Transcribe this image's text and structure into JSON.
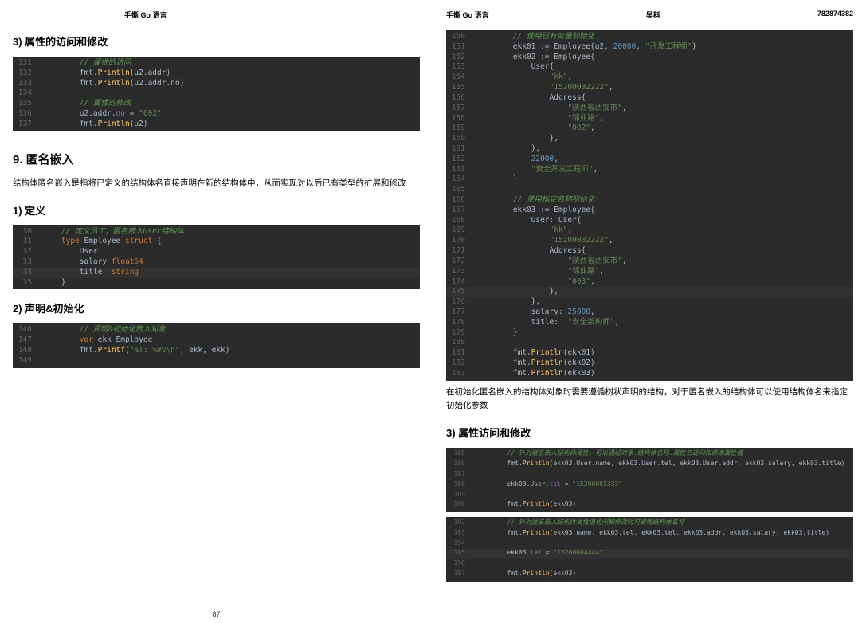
{
  "header": {
    "title": "手撕 Go 语言",
    "author": "吴科",
    "id": "782874382"
  },
  "left": {
    "h1": "3) 属性的访问和修改",
    "code1": [
      {
        "n": 131,
        "seg": [
          {
            "c": "cm",
            "t": "// 属性的访问"
          }
        ],
        "ind": 2
      },
      {
        "n": 132,
        "seg": [
          {
            "c": "",
            "t": "fmt."
          },
          {
            "c": "fn",
            "t": "Println"
          },
          {
            "c": "",
            "t": "(u2.addr)"
          }
        ],
        "ind": 2
      },
      {
        "n": 133,
        "seg": [
          {
            "c": "",
            "t": "fmt."
          },
          {
            "c": "fn",
            "t": "Println"
          },
          {
            "c": "",
            "t": "(u2.addr.no)"
          }
        ],
        "ind": 2
      },
      {
        "n": 134,
        "seg": [],
        "ind": 0
      },
      {
        "n": 135,
        "seg": [
          {
            "c": "cm",
            "t": "// 属性的修改"
          }
        ],
        "ind": 2
      },
      {
        "n": 136,
        "seg": [
          {
            "c": "",
            "t": "u2.addr."
          },
          {
            "c": "id",
            "t": "no"
          },
          {
            "c": "",
            "t": " = "
          },
          {
            "c": "str",
            "t": "\"002\""
          }
        ],
        "ind": 2
      },
      {
        "n": 137,
        "seg": [
          {
            "c": "",
            "t": "fmt."
          },
          {
            "c": "fn",
            "t": "Println"
          },
          {
            "c": "",
            "t": "(u2)"
          }
        ],
        "ind": 2
      }
    ],
    "h2": "9. 匿名嵌入",
    "p1": "结构体匿名嵌入是指将已定义的结构体名直接声明在新的结构体中，从而实现对以后已有类型的扩展和修改",
    "h3": "1) 定义",
    "code2": [
      {
        "n": 30,
        "seg": [
          {
            "c": "cm",
            "t": "// 定义员工，匿名嵌入User结构体"
          }
        ],
        "ind": 1
      },
      {
        "n": 31,
        "seg": [
          {
            "c": "kw",
            "t": "type"
          },
          {
            "c": "",
            "t": " Employee "
          },
          {
            "c": "kw",
            "t": "struct"
          },
          {
            "c": "",
            "t": " {"
          }
        ],
        "ind": 1
      },
      {
        "n": 32,
        "seg": [
          {
            "c": "",
            "t": "User"
          }
        ],
        "ind": 2
      },
      {
        "n": 33,
        "seg": [
          {
            "c": "",
            "t": "salary "
          },
          {
            "c": "kw",
            "t": "float64"
          }
        ],
        "ind": 2
      },
      {
        "n": 34,
        "seg": [
          {
            "c": "",
            "t": "title  "
          },
          {
            "c": "kw",
            "t": "string"
          }
        ],
        "ind": 2,
        "hl": true
      },
      {
        "n": 35,
        "seg": [
          {
            "c": "",
            "t": "}"
          }
        ],
        "ind": 1
      }
    ],
    "h4": "2) 声明&初始化",
    "code3": [
      {
        "n": 146,
        "seg": [
          {
            "c": "cm",
            "t": "// 声明&初始化嵌入对象"
          }
        ],
        "ind": 2
      },
      {
        "n": 147,
        "seg": [
          {
            "c": "kw",
            "t": "var"
          },
          {
            "c": "",
            "t": " ekk Employee"
          }
        ],
        "ind": 2
      },
      {
        "n": 148,
        "seg": [
          {
            "c": "",
            "t": "fmt."
          },
          {
            "c": "fn",
            "t": "Printf"
          },
          {
            "c": "",
            "t": "("
          },
          {
            "c": "str",
            "t": "\"%T: %#v\\n\""
          },
          {
            "c": "",
            "t": ", ekk, ekk)"
          }
        ],
        "ind": 2
      },
      {
        "n": 149,
        "seg": [],
        "ind": 0
      }
    ],
    "pageno": "87"
  },
  "right": {
    "code1": [
      {
        "n": 150,
        "seg": [
          {
            "c": "cm",
            "t": "// 使用已有变量初始化"
          }
        ],
        "ind": 2
      },
      {
        "n": 151,
        "seg": [
          {
            "c": "",
            "t": "ekk01 := Employee{u2, "
          },
          {
            "c": "num",
            "t": "20000"
          },
          {
            "c": "",
            "t": ", "
          },
          {
            "c": "str",
            "t": "\"开发工程师\""
          },
          {
            "c": "",
            "t": "}"
          }
        ],
        "ind": 2
      },
      {
        "n": 152,
        "seg": [
          {
            "c": "",
            "t": "ekk02 := Employee{"
          }
        ],
        "ind": 2
      },
      {
        "n": 153,
        "seg": [
          {
            "c": "",
            "t": "User{"
          }
        ],
        "ind": 3
      },
      {
        "n": 154,
        "seg": [
          {
            "c": "str",
            "t": "\"kk\""
          },
          {
            "c": "",
            "t": ","
          }
        ],
        "ind": 4
      },
      {
        "n": 155,
        "seg": [
          {
            "c": "str",
            "t": "\"15200002222\""
          },
          {
            "c": "",
            "t": ","
          }
        ],
        "ind": 4
      },
      {
        "n": 156,
        "seg": [
          {
            "c": "",
            "t": "Address{"
          }
        ],
        "ind": 4
      },
      {
        "n": 157,
        "seg": [
          {
            "c": "str",
            "t": "\"陕西省西安市\""
          },
          {
            "c": "",
            "t": ","
          }
        ],
        "ind": 5
      },
      {
        "n": 158,
        "seg": [
          {
            "c": "str",
            "t": "\"锦业路\""
          },
          {
            "c": "",
            "t": ","
          }
        ],
        "ind": 5
      },
      {
        "n": 159,
        "seg": [
          {
            "c": "str",
            "t": "\"002\""
          },
          {
            "c": "",
            "t": ","
          }
        ],
        "ind": 5
      },
      {
        "n": 160,
        "seg": [
          {
            "c": "",
            "t": "},"
          }
        ],
        "ind": 4
      },
      {
        "n": 161,
        "seg": [
          {
            "c": "",
            "t": "},"
          }
        ],
        "ind": 3
      },
      {
        "n": 162,
        "seg": [
          {
            "c": "num",
            "t": "22000"
          },
          {
            "c": "",
            "t": ","
          }
        ],
        "ind": 3
      },
      {
        "n": 163,
        "seg": [
          {
            "c": "str",
            "t": "\"安全开发工程师\""
          },
          {
            "c": "",
            "t": ","
          }
        ],
        "ind": 3
      },
      {
        "n": 164,
        "seg": [
          {
            "c": "",
            "t": "}"
          }
        ],
        "ind": 2
      },
      {
        "n": 165,
        "seg": [],
        "ind": 0
      },
      {
        "n": 166,
        "seg": [
          {
            "c": "cm",
            "t": "// 使用指定名称初始化"
          }
        ],
        "ind": 2
      },
      {
        "n": 167,
        "seg": [
          {
            "c": "",
            "t": "ekk03 := Employee{"
          }
        ],
        "ind": 2
      },
      {
        "n": 168,
        "seg": [
          {
            "c": "",
            "t": "User: User{"
          }
        ],
        "ind": 3
      },
      {
        "n": 169,
        "seg": [
          {
            "c": "str",
            "t": "\"kk\""
          },
          {
            "c": "",
            "t": ","
          }
        ],
        "ind": 4
      },
      {
        "n": 170,
        "seg": [
          {
            "c": "str",
            "t": "\"15200002222\""
          },
          {
            "c": "",
            "t": ","
          }
        ],
        "ind": 4
      },
      {
        "n": 171,
        "seg": [
          {
            "c": "",
            "t": "Address{"
          }
        ],
        "ind": 4
      },
      {
        "n": 172,
        "seg": [
          {
            "c": "str",
            "t": "\"陕西省西安市\""
          },
          {
            "c": "",
            "t": ","
          }
        ],
        "ind": 5
      },
      {
        "n": 173,
        "seg": [
          {
            "c": "str",
            "t": "\"锦业路\""
          },
          {
            "c": "",
            "t": ","
          }
        ],
        "ind": 5
      },
      {
        "n": 174,
        "seg": [
          {
            "c": "str",
            "t": "\"003\""
          },
          {
            "c": "",
            "t": ","
          }
        ],
        "ind": 5
      },
      {
        "n": 175,
        "seg": [
          {
            "c": "",
            "t": "},"
          }
        ],
        "ind": 4,
        "hl": true
      },
      {
        "n": 176,
        "seg": [
          {
            "c": "",
            "t": "},"
          }
        ],
        "ind": 3
      },
      {
        "n": 177,
        "seg": [
          {
            "c": "",
            "t": "salary: "
          },
          {
            "c": "num",
            "t": "25000"
          },
          {
            "c": "",
            "t": ","
          }
        ],
        "ind": 3
      },
      {
        "n": 178,
        "seg": [
          {
            "c": "",
            "t": "title:  "
          },
          {
            "c": "str",
            "t": "\"安全架构师\""
          },
          {
            "c": "",
            "t": ","
          }
        ],
        "ind": 3
      },
      {
        "n": 179,
        "seg": [
          {
            "c": "",
            "t": "}"
          }
        ],
        "ind": 2
      },
      {
        "n": 180,
        "seg": [],
        "ind": 0
      },
      {
        "n": 181,
        "seg": [
          {
            "c": "",
            "t": "fmt."
          },
          {
            "c": "fn",
            "t": "Println"
          },
          {
            "c": "",
            "t": "(ekk01)"
          }
        ],
        "ind": 2
      },
      {
        "n": 182,
        "seg": [
          {
            "c": "",
            "t": "fmt."
          },
          {
            "c": "fn",
            "t": "Println"
          },
          {
            "c": "",
            "t": "(ekk02)"
          }
        ],
        "ind": 2
      },
      {
        "n": 183,
        "seg": [
          {
            "c": "",
            "t": "fmt."
          },
          {
            "c": "fn",
            "t": "Println"
          },
          {
            "c": "",
            "t": "(ekk03)"
          }
        ],
        "ind": 2
      }
    ],
    "p1": "在初始化匿名嵌入的结构体对象时需要遵循树状声明的结构，对于匿名嵌入的结构体可以使用结构体名来指定初始化参数",
    "h1": "3) 属性访问和修改",
    "code2": [
      {
        "n": 185,
        "seg": [
          {
            "c": "cm",
            "t": "// 针对匿名嵌入结构体属性，可以通过对象.结构体名称.属性名访问和修改属性值"
          }
        ],
        "ind": 2
      },
      {
        "n": 186,
        "seg": [
          {
            "c": "",
            "t": "fmt."
          },
          {
            "c": "fn",
            "t": "Println"
          },
          {
            "c": "",
            "t": "(ekk03.User.name, ekk03.User.tel, ekk03.User.addr, ekk03.salary, ekk03.title)"
          }
        ],
        "ind": 2
      },
      {
        "n": 187,
        "seg": [],
        "ind": 0
      },
      {
        "n": 188,
        "seg": [
          {
            "c": "",
            "t": "ekk03.User."
          },
          {
            "c": "id",
            "t": "tel"
          },
          {
            "c": "",
            "t": " = "
          },
          {
            "c": "str",
            "t": "\"15200003333\""
          }
        ],
        "ind": 2
      },
      {
        "n": 189,
        "seg": [],
        "ind": 0
      },
      {
        "n": 190,
        "seg": [
          {
            "c": "",
            "t": "fmt."
          },
          {
            "c": "fn",
            "t": "Println"
          },
          {
            "c": "",
            "t": "(ekk03)"
          }
        ],
        "ind": 2
      }
    ],
    "code3": [
      {
        "n": 192,
        "seg": [
          {
            "c": "cm",
            "t": "// 针对匿名嵌入结构体属性值访问和修改时可省略结构体名称"
          }
        ],
        "ind": 2
      },
      {
        "n": 193,
        "seg": [
          {
            "c": "",
            "t": "fmt."
          },
          {
            "c": "fn",
            "t": "Println"
          },
          {
            "c": "",
            "t": "(ekk03.name, ekk03.tel, ekk03.tel, ekk03.addr, ekk03.salary, ekk03.title)"
          }
        ],
        "ind": 2
      },
      {
        "n": 194,
        "seg": [],
        "ind": 0
      },
      {
        "n": 195,
        "seg": [
          {
            "c": "",
            "t": "ekk03."
          },
          {
            "c": "id",
            "t": "tel"
          },
          {
            "c": "",
            "t": " = "
          },
          {
            "c": "str",
            "t": "\"15200004444\""
          }
        ],
        "ind": 2,
        "hl": true
      },
      {
        "n": 196,
        "seg": [],
        "ind": 0
      },
      {
        "n": 197,
        "seg": [
          {
            "c": "",
            "t": "fmt."
          },
          {
            "c": "fn",
            "t": "Println"
          },
          {
            "c": "",
            "t": "(ekk03)"
          }
        ],
        "ind": 2
      }
    ]
  }
}
